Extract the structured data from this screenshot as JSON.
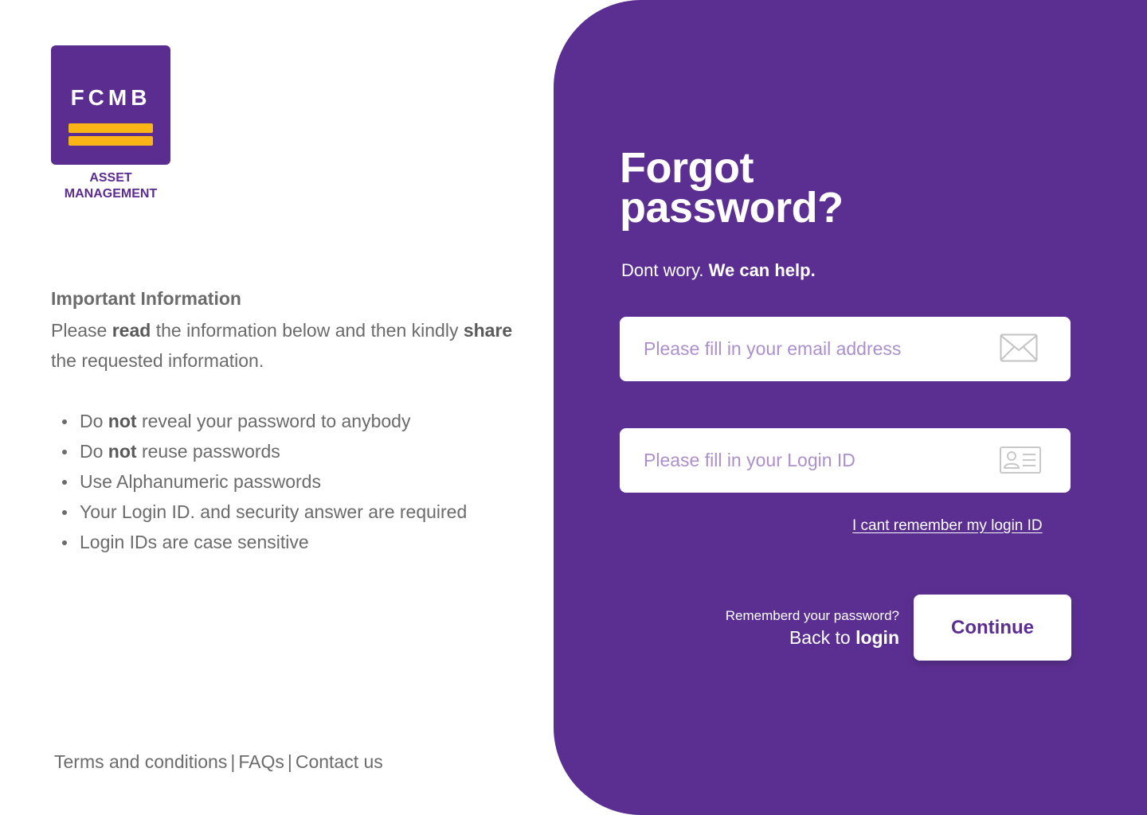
{
  "brand": {
    "logo_text": "FCMB",
    "sub_line1": "ASSET",
    "sub_line2": "MANAGEMENT",
    "primary_color": "#5b2d90",
    "accent_color": "#fbb415"
  },
  "info": {
    "title": "Important Information",
    "desc_part1": "Please ",
    "desc_bold1": "read",
    "desc_part2": " the information below and then kindly ",
    "desc_bold2": "share",
    "desc_part3": " the requested information.",
    "items": [
      {
        "pre": "Do ",
        "bold": "not",
        "post": " reveal your password to anybody"
      },
      {
        "pre": "Do ",
        "bold": "not",
        "post": " reuse passwords"
      },
      {
        "pre": "Use Alphanumeric passwords",
        "bold": "",
        "post": ""
      },
      {
        "pre": "Your Login ID. and security answer are required",
        "bold": "",
        "post": ""
      },
      {
        "pre": "Login IDs are case sensitive",
        "bold": "",
        "post": ""
      }
    ]
  },
  "footer": {
    "terms": "Terms and conditions",
    "faqs": "FAQs",
    "contact": "Contact us",
    "separator": "|"
  },
  "form": {
    "title_line1": "Forgot",
    "title_line2": "password?",
    "subtitle_regular": "Dont wory. ",
    "subtitle_bold": "We can help.",
    "email_placeholder": "Please fill in your email address",
    "email_value": "",
    "email_icon": "envelope-icon",
    "login_placeholder": "Please fill in your Login ID",
    "login_value": "",
    "login_icon": "id-card-icon",
    "forgot_id_link": "I cant remember my login ID",
    "remembered_text": "Rememberd your password?",
    "back_regular": "Back to ",
    "back_bold": "login",
    "continue_label": "Continue"
  }
}
